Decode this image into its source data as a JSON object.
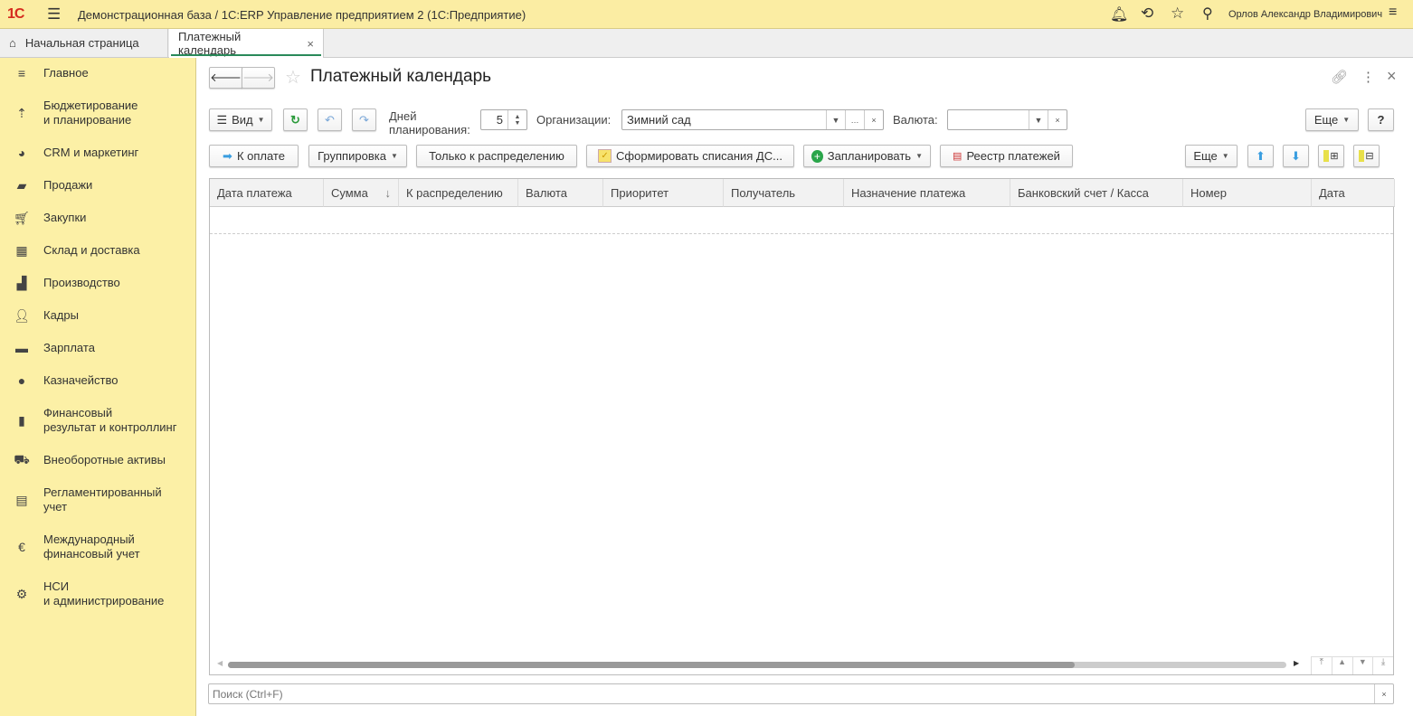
{
  "topbar": {
    "logo": "1С",
    "title": "Демонстрационная база / 1С:ERP Управление предприятием 2  (1С:Предприятие)",
    "user": "Орлов Александр Владимирович"
  },
  "tabs": [
    {
      "label": "Начальная страница"
    },
    {
      "label": "Платежный календарь",
      "active": true
    }
  ],
  "sidebar": {
    "items": [
      {
        "label": "Главное",
        "icon": "menu-icon"
      },
      {
        "label": "Бюджетирование\nи планирование",
        "icon": "budget-icon"
      },
      {
        "label": "CRM и маркетинг",
        "icon": "pie-icon"
      },
      {
        "label": "Продажи",
        "icon": "bag-icon"
      },
      {
        "label": "Закупки",
        "icon": "cart-icon"
      },
      {
        "label": "Склад и доставка",
        "icon": "warehouse-icon"
      },
      {
        "label": "Производство",
        "icon": "factory-icon"
      },
      {
        "label": "Кадры",
        "icon": "person-icon"
      },
      {
        "label": "Зарплата",
        "icon": "wallet-icon"
      },
      {
        "label": "Казначейство",
        "icon": "ruble-icon"
      },
      {
        "label": "Финансовый\nрезультат и контроллинг",
        "icon": "chart-icon"
      },
      {
        "label": "Внеоборотные активы",
        "icon": "truck-icon"
      },
      {
        "label": "Регламентированный\nучет",
        "icon": "calculator-icon"
      },
      {
        "label": "Международный\nфинансовый учет",
        "icon": "euro-icon"
      },
      {
        "label": "НСИ\nи администрирование",
        "icon": "gear-icon"
      }
    ]
  },
  "form": {
    "title": "Платежный календарь",
    "toolbar1": {
      "view": "Вид",
      "days_label": "Дней\nпланирования:",
      "days_value": "5",
      "org_label": "Организации:",
      "org_value": "Зимний сад",
      "currency_label": "Валюта:",
      "currency_value": "",
      "more": "Еще",
      "help": "?"
    },
    "toolbar2": {
      "to_pay": "К оплате",
      "grouping": "Группировка",
      "only_distribution": "Только к распределению",
      "generate": "Сформировать списания ДС...",
      "plan": "Запланировать",
      "registry": "Реестр платежей",
      "more": "Еще"
    },
    "columns": [
      "Дата платежа",
      "Сумма",
      "К распределению",
      "Валюта",
      "Приоритет",
      "Получатель",
      "Назначение платежа",
      "Банковский счет / Касса",
      "Номер",
      "Дата"
    ],
    "sort_indicator": "↓",
    "search_placeholder": "Поиск (Ctrl+F)",
    "scroll_fraction": 0.8
  }
}
